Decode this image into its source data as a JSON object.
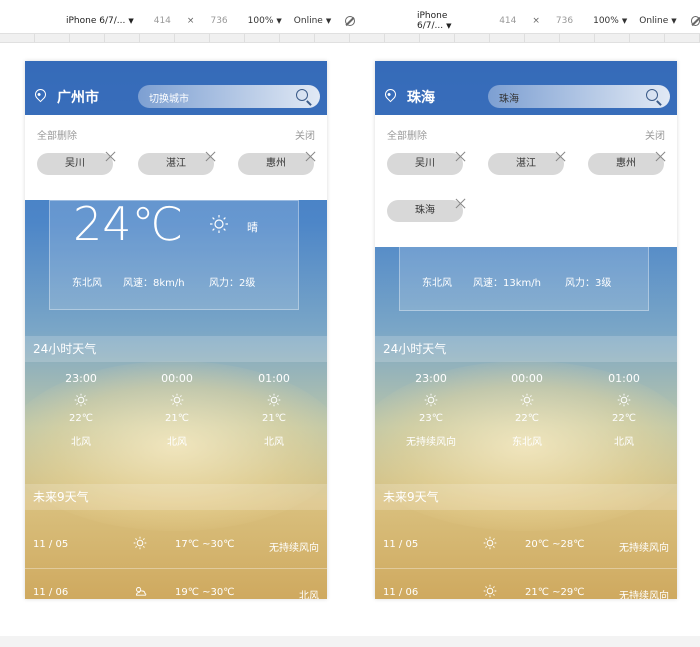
{
  "toolbar": {
    "device": "iPhone 6/7/...",
    "width": "414",
    "times": "×",
    "height": "736",
    "zoom": "100%",
    "network": "Online"
  },
  "phones": [
    {
      "city": "广州市",
      "search_text": "切换城市",
      "panel": {
        "clear_all": "全部删除",
        "close": "关闭",
        "tags": [
          "吴川",
          "湛江",
          "惠州"
        ]
      },
      "now": {
        "temp": "24℃",
        "condition": "晴",
        "wind_dir": "东北风",
        "wind_speed": "风速：8km/h",
        "wind_level": "风力：2级"
      },
      "hourly_title": "24小时天气",
      "hourly": [
        {
          "time": "23:00",
          "temp": "22℃",
          "wind": "北风"
        },
        {
          "time": "00:00",
          "temp": "21℃",
          "wind": "北风"
        },
        {
          "time": "01:00",
          "temp": "21℃",
          "wind": "北风"
        }
      ],
      "daily_title": "未来9天气",
      "daily": [
        {
          "date": "11 / 05",
          "range": "17℃ ~30℃",
          "wind": "无持续风向",
          "icon": "sun-icon"
        },
        {
          "date": "11 / 06",
          "range": "19℃ ~30℃",
          "wind": "北风",
          "icon": "cloud-sun-icon"
        }
      ]
    },
    {
      "city": "珠海",
      "search_text": "珠海",
      "panel": {
        "clear_all": "全部删除",
        "close": "关闭",
        "tags": [
          "吴川",
          "湛江",
          "惠州",
          "珠海"
        ]
      },
      "now": {
        "temp": "",
        "condition": "",
        "wind_dir": "东北风",
        "wind_speed": "风速：13km/h",
        "wind_level": "风力：3级"
      },
      "hourly_title": "24小时天气",
      "hourly": [
        {
          "time": "23:00",
          "temp": "23℃",
          "wind": "无持续风向"
        },
        {
          "time": "00:00",
          "temp": "22℃",
          "wind": "东北风"
        },
        {
          "time": "01:00",
          "temp": "22℃",
          "wind": "北风"
        }
      ],
      "daily_title": "未来9天气",
      "daily": [
        {
          "date": "11 / 05",
          "range": "20℃ ~28℃",
          "wind": "无持续风向",
          "icon": "sun-icon"
        },
        {
          "date": "11 / 06",
          "range": "21℃ ~29℃",
          "wind": "无持续风向",
          "icon": "sun-icon"
        }
      ]
    }
  ]
}
